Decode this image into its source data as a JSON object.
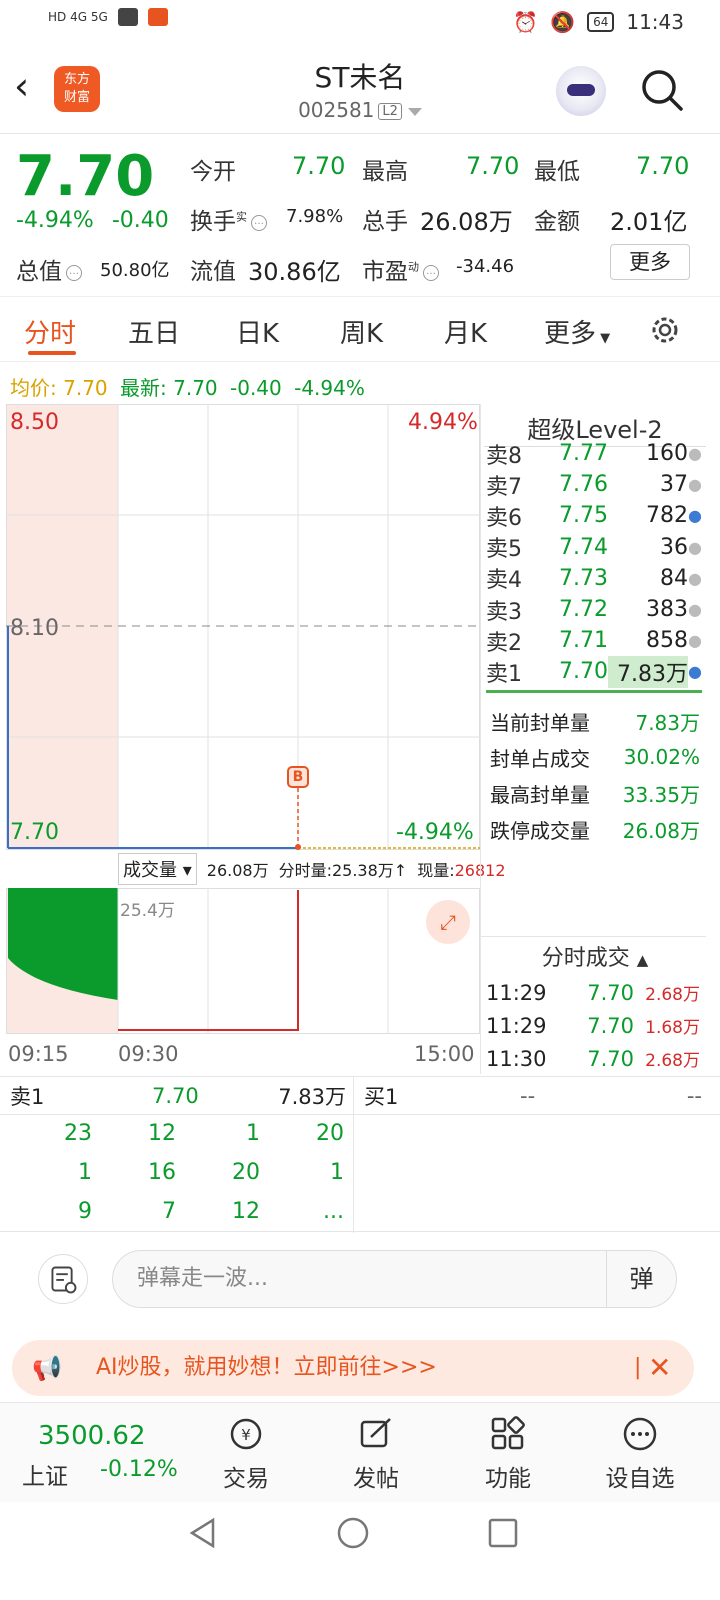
{
  "status": {
    "time": "11:43",
    "battery": "64"
  },
  "header": {
    "title": "ST未名",
    "code": "002581",
    "l2": "L2",
    "logo_line1": "东方",
    "logo_line2": "财富"
  },
  "quote": {
    "price": "7.70",
    "pct": "-4.94%",
    "chg": "-0.40",
    "open_label": "今开",
    "open": "7.70",
    "high_label": "最高",
    "high": "7.70",
    "low_label": "最低",
    "low": "7.70",
    "turnover_label": "换手",
    "turnover_sup": "实",
    "turnover": "7.98%",
    "vol_label": "总手",
    "vol": "26.08万",
    "amount_label": "金额",
    "amount": "2.01亿",
    "mcap_label": "总值",
    "mcap": "50.80亿",
    "float_label": "流值",
    "float": "30.86亿",
    "pe_label": "市盈",
    "pe_sup": "动",
    "pe": "-34.46",
    "more": "更多"
  },
  "tabs": [
    "分时",
    "五日",
    "日K",
    "周K",
    "月K",
    "更多"
  ],
  "avg_line": {
    "avg_label": "均价:",
    "avg": "7.70",
    "latest_label": "最新:",
    "latest": "7.70",
    "chg": "-0.40",
    "pct": "-4.94%"
  },
  "chart": {
    "y_top": "8.50",
    "y_mid": "8.10",
    "y_bot": "7.70",
    "pct_top": "4.94%",
    "pct_bot": "-4.94%",
    "marker": "B",
    "vol_label": "成交量",
    "vol_total": "26.08万",
    "min_vol": "分时量:25.38万↑",
    "now_label": "现量:",
    "now": "26812",
    "vol_max": "25.4万",
    "x_start": "09:15",
    "x_open": "09:30",
    "x_end": "15:00"
  },
  "level2": {
    "title": "超级Level-2",
    "asks": [
      {
        "label": "卖8",
        "price": "7.77",
        "vol": "160"
      },
      {
        "label": "卖7",
        "price": "7.76",
        "vol": "37"
      },
      {
        "label": "卖6",
        "price": "7.75",
        "vol": "782"
      },
      {
        "label": "卖5",
        "price": "7.74",
        "vol": "36"
      },
      {
        "label": "卖4",
        "price": "7.73",
        "vol": "84"
      },
      {
        "label": "卖3",
        "price": "7.72",
        "vol": "383"
      },
      {
        "label": "卖2",
        "price": "7.71",
        "vol": "858"
      },
      {
        "label": "卖1",
        "price": "7.70",
        "vol": "7.83万"
      }
    ],
    "seal": [
      {
        "label": "当前封单量",
        "value": "7.83万"
      },
      {
        "label": "封单占成交",
        "value": "30.02%"
      },
      {
        "label": "最高封单量",
        "value": "33.35万"
      },
      {
        "label": "跌停成交量",
        "value": "26.08万"
      }
    ]
  },
  "ticks": {
    "title": "分时成交",
    "rows": [
      {
        "time": "11:29",
        "price": "7.70",
        "vol": "2.68万"
      },
      {
        "time": "11:29",
        "price": "7.70",
        "vol": "1.68万"
      },
      {
        "time": "11:30",
        "price": "7.70",
        "vol": "2.68万"
      }
    ]
  },
  "queue": {
    "sell_label": "卖1",
    "sell_price": "7.70",
    "sell_vol": "7.83万",
    "buy_label": "买1",
    "buy_price": "--",
    "buy_vol": "--",
    "cells": [
      [
        "23",
        "12",
        "1",
        "20"
      ],
      [
        "1",
        "16",
        "20",
        "1"
      ],
      [
        "9",
        "7",
        "12",
        "..."
      ]
    ]
  },
  "comment": {
    "placeholder": "弹幕走一波...",
    "danmu": "弹"
  },
  "promo": {
    "text": "AI炒股，就用妙想！立即前往>>>"
  },
  "bottom_nav": {
    "index_value": "3500.62",
    "index_name": "上证",
    "index_pct": "-0.12%",
    "items": [
      "交易",
      "发帖",
      "功能",
      "设自选"
    ]
  }
}
